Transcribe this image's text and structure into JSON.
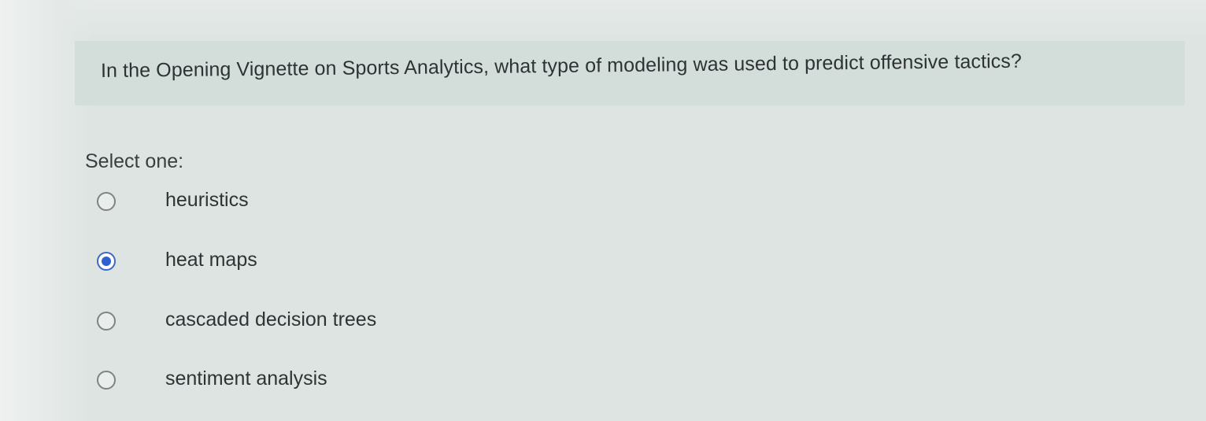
{
  "question": {
    "text": "In the Opening Vignette on Sports Analytics, what type of modeling was used to predict offensive tactics?"
  },
  "prompt": {
    "select_label": "Select one:"
  },
  "options": [
    {
      "label": "heuristics",
      "selected": false
    },
    {
      "label": "heat maps",
      "selected": true
    },
    {
      "label": "cascaded decision trees",
      "selected": false
    },
    {
      "label": "sentiment analysis",
      "selected": false
    }
  ],
  "colors": {
    "selected_radio": "#2f5fd0",
    "question_background": "#d3deda",
    "page_background": "#dde4e1"
  }
}
